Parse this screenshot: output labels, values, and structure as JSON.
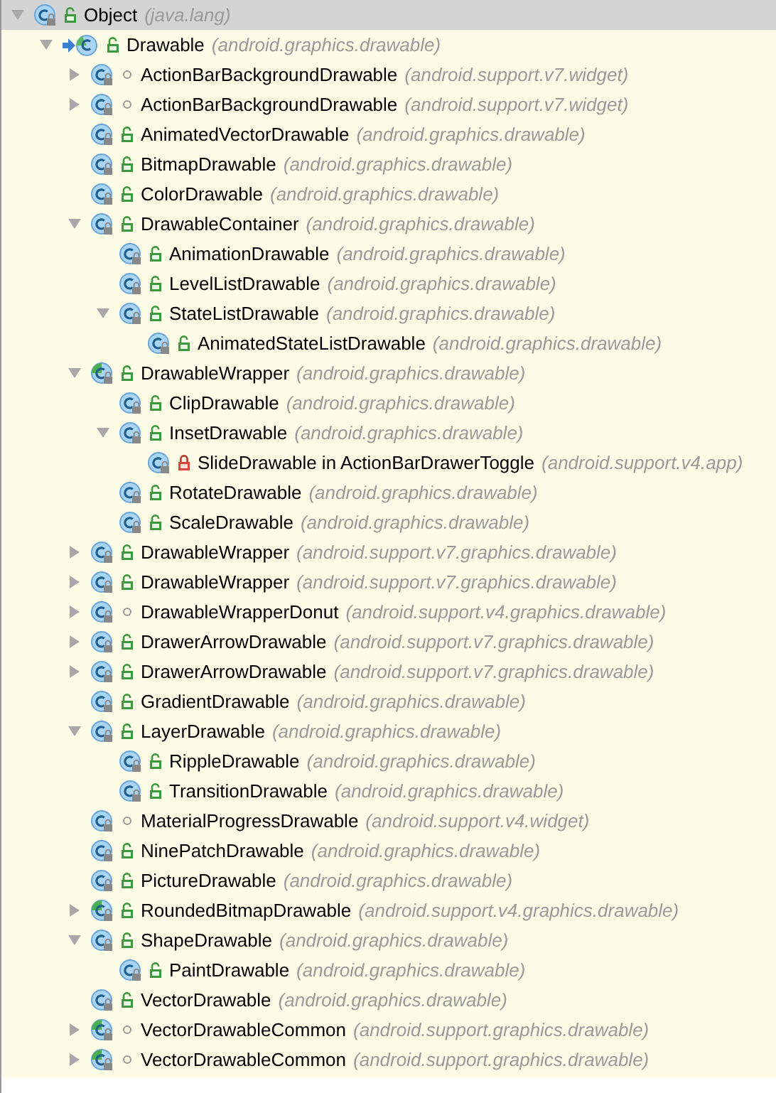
{
  "tree": [
    {
      "name": "Object",
      "package": "(java.lang)",
      "kind": "class",
      "private": false,
      "package_local": false,
      "selected": true,
      "expanded": true,
      "children": [
        {
          "name": "Drawable",
          "package": "(android.graphics.drawable)",
          "kind": "base",
          "private": false,
          "package_local": false,
          "selected": false,
          "expanded": true,
          "children": [
            {
              "name": "ActionBarBackgroundDrawable",
              "package": "(android.support.v7.widget)",
              "kind": "class",
              "private": false,
              "package_local": true,
              "selected": false,
              "expanded": false
            },
            {
              "name": "ActionBarBackgroundDrawable",
              "package": "(android.support.v7.widget)",
              "kind": "class",
              "private": false,
              "package_local": true,
              "selected": false,
              "expanded": false
            },
            {
              "name": "AnimatedVectorDrawable",
              "package": "(android.graphics.drawable)",
              "kind": "class",
              "private": false,
              "package_local": false,
              "selected": false
            },
            {
              "name": "BitmapDrawable",
              "package": "(android.graphics.drawable)",
              "kind": "class",
              "private": false,
              "package_local": false,
              "selected": false
            },
            {
              "name": "ColorDrawable",
              "package": "(android.graphics.drawable)",
              "kind": "class",
              "private": false,
              "package_local": false,
              "selected": false
            },
            {
              "name": "DrawableContainer",
              "package": "(android.graphics.drawable)",
              "kind": "class",
              "private": false,
              "package_local": false,
              "selected": false,
              "expanded": true,
              "children": [
                {
                  "name": "AnimationDrawable",
                  "package": "(android.graphics.drawable)",
                  "kind": "class",
                  "private": false,
                  "package_local": false,
                  "selected": false
                },
                {
                  "name": "LevelListDrawable",
                  "package": "(android.graphics.drawable)",
                  "kind": "class",
                  "private": false,
                  "package_local": false,
                  "selected": false
                },
                {
                  "name": "StateListDrawable",
                  "package": "(android.graphics.drawable)",
                  "kind": "class",
                  "private": false,
                  "package_local": false,
                  "selected": false,
                  "expanded": true,
                  "children": [
                    {
                      "name": "AnimatedStateListDrawable",
                      "package": "(android.graphics.drawable)",
                      "kind": "class",
                      "private": false,
                      "package_local": false,
                      "selected": false
                    }
                  ]
                }
              ]
            },
            {
              "name": "DrawableWrapper",
              "package": "(android.graphics.drawable)",
              "kind": "abstract",
              "private": false,
              "package_local": false,
              "selected": false,
              "expanded": true,
              "children": [
                {
                  "name": "ClipDrawable",
                  "package": "(android.graphics.drawable)",
                  "kind": "class",
                  "private": false,
                  "package_local": false,
                  "selected": false
                },
                {
                  "name": "InsetDrawable",
                  "package": "(android.graphics.drawable)",
                  "kind": "class",
                  "private": false,
                  "package_local": false,
                  "selected": false,
                  "expanded": true,
                  "children": [
                    {
                      "name": "SlideDrawable in ActionBarDrawerToggle",
                      "package": "(android.support.v4.app)",
                      "kind": "class",
                      "private": true,
                      "package_local": false,
                      "selected": false
                    }
                  ]
                },
                {
                  "name": "RotateDrawable",
                  "package": "(android.graphics.drawable)",
                  "kind": "class",
                  "private": false,
                  "package_local": false,
                  "selected": false
                },
                {
                  "name": "ScaleDrawable",
                  "package": "(android.graphics.drawable)",
                  "kind": "class",
                  "private": false,
                  "package_local": false,
                  "selected": false
                }
              ]
            },
            {
              "name": "DrawableWrapper",
              "package": "(android.support.v7.graphics.drawable)",
              "kind": "class",
              "private": false,
              "package_local": false,
              "selected": false,
              "expanded": false
            },
            {
              "name": "DrawableWrapper",
              "package": "(android.support.v7.graphics.drawable)",
              "kind": "class",
              "private": false,
              "package_local": false,
              "selected": false,
              "expanded": false
            },
            {
              "name": "DrawableWrapperDonut",
              "package": "(android.support.v4.graphics.drawable)",
              "kind": "class",
              "private": false,
              "package_local": true,
              "selected": false,
              "expanded": false
            },
            {
              "name": "DrawerArrowDrawable",
              "package": "(android.support.v7.graphics.drawable)",
              "kind": "class",
              "private": false,
              "package_local": false,
              "selected": false,
              "expanded": false
            },
            {
              "name": "DrawerArrowDrawable",
              "package": "(android.support.v7.graphics.drawable)",
              "kind": "class",
              "private": false,
              "package_local": false,
              "selected": false,
              "expanded": false
            },
            {
              "name": "GradientDrawable",
              "package": "(android.graphics.drawable)",
              "kind": "class",
              "private": false,
              "package_local": false,
              "selected": false
            },
            {
              "name": "LayerDrawable",
              "package": "(android.graphics.drawable)",
              "kind": "class",
              "private": false,
              "package_local": false,
              "selected": false,
              "expanded": true,
              "children": [
                {
                  "name": "RippleDrawable",
                  "package": "(android.graphics.drawable)",
                  "kind": "class",
                  "private": false,
                  "package_local": false,
                  "selected": false
                },
                {
                  "name": "TransitionDrawable",
                  "package": "(android.graphics.drawable)",
                  "kind": "class",
                  "private": false,
                  "package_local": false,
                  "selected": false
                }
              ]
            },
            {
              "name": "MaterialProgressDrawable",
              "package": "(android.support.v4.widget)",
              "kind": "class",
              "private": false,
              "package_local": true,
              "selected": false
            },
            {
              "name": "NinePatchDrawable",
              "package": "(android.graphics.drawable)",
              "kind": "class",
              "private": false,
              "package_local": false,
              "selected": false
            },
            {
              "name": "PictureDrawable",
              "package": "(android.graphics.drawable)",
              "kind": "class",
              "private": false,
              "package_local": false,
              "selected": false
            },
            {
              "name": "RoundedBitmapDrawable",
              "package": "(android.support.v4.graphics.drawable)",
              "kind": "abstract",
              "private": false,
              "package_local": false,
              "selected": false,
              "expanded": false
            },
            {
              "name": "ShapeDrawable",
              "package": "(android.graphics.drawable)",
              "kind": "class",
              "private": false,
              "package_local": false,
              "selected": false,
              "expanded": true,
              "children": [
                {
                  "name": "PaintDrawable",
                  "package": "(android.graphics.drawable)",
                  "kind": "class",
                  "private": false,
                  "package_local": false,
                  "selected": false
                }
              ]
            },
            {
              "name": "VectorDrawable",
              "package": "(android.graphics.drawable)",
              "kind": "class",
              "private": false,
              "package_local": false,
              "selected": false
            },
            {
              "name": "VectorDrawableCommon",
              "package": "(android.support.graphics.drawable)",
              "kind": "abstract",
              "private": false,
              "package_local": true,
              "selected": false,
              "expanded": false
            },
            {
              "name": "VectorDrawableCommon",
              "package": "(android.support.graphics.drawable)",
              "kind": "abstract",
              "private": false,
              "package_local": true,
              "selected": false,
              "expanded": false
            }
          ]
        }
      ]
    }
  ]
}
